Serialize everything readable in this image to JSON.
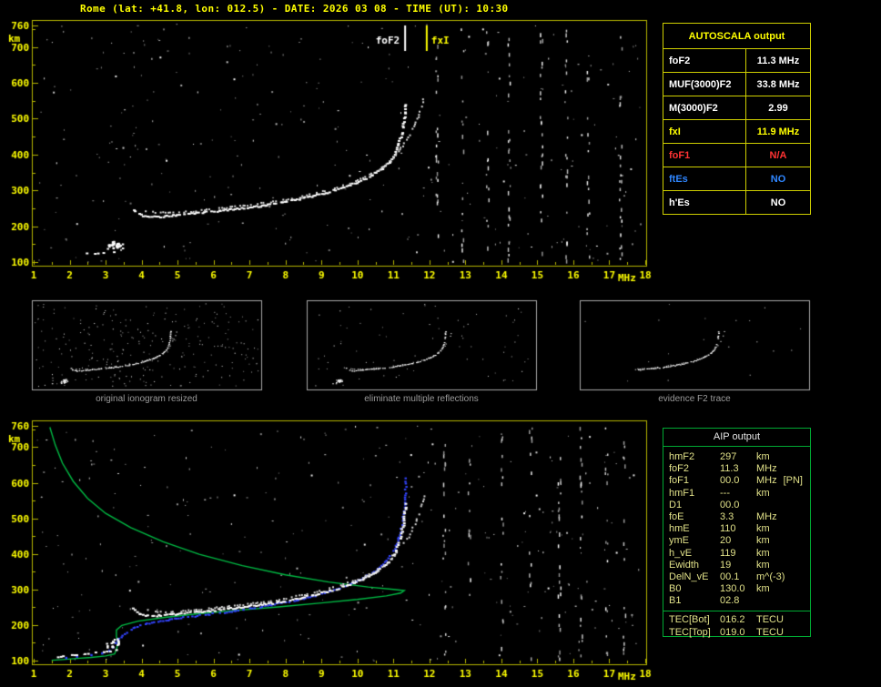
{
  "title": "Rome (lat: +41.8, lon: 012.5) - DATE: 2026 03 08 - TIME (UT): 10:30",
  "colors": {
    "accent_yellow": "#ffff00",
    "plot_border": "#b6b600",
    "profile_green": "#00bb44",
    "trace_blue": "#3344ff",
    "alert_red": "#ff3333",
    "info_blue": "#2f86ff",
    "panel_border": "#a8a8a8",
    "caption_gray": "#9a9a9a"
  },
  "autoscala_table": {
    "title": "AUTOSCALA output",
    "rows": [
      {
        "label": "foF2",
        "value": "11.3 MHz",
        "color": "#ffffff"
      },
      {
        "label": "MUF(3000)F2",
        "value": "33.8 MHz",
        "color": "#ffffff"
      },
      {
        "label": "M(3000)F2",
        "value": "2.99",
        "color": "#ffffff"
      },
      {
        "label": "fxI",
        "value": "11.9 MHz",
        "color": "#ffff00"
      },
      {
        "label": "foF1",
        "value": "N/A",
        "color": "#ff3333"
      },
      {
        "label": "ftEs",
        "value": "NO",
        "color": "#2f86ff"
      },
      {
        "label": "h'Es",
        "value": "NO",
        "color": "#ffffff"
      }
    ]
  },
  "aip_table": {
    "title": "AIP output",
    "rows": [
      {
        "label": "hmF2",
        "value": "297",
        "unit": "km"
      },
      {
        "label": "foF2",
        "value": "11.3",
        "unit": "MHz"
      },
      {
        "label": "foF1",
        "value": "00.0",
        "unit": "MHz",
        "note": "[PN]"
      },
      {
        "label": "hmF1",
        "value": "---",
        "unit": "km"
      },
      {
        "label": "D1",
        "value": "00.0",
        "unit": ""
      },
      {
        "label": "foE",
        "value": "3.3",
        "unit": "MHz"
      },
      {
        "label": "hmE",
        "value": "110",
        "unit": "km"
      },
      {
        "label": "ymE",
        "value": "20",
        "unit": "km"
      },
      {
        "label": "h_vE",
        "value": "119",
        "unit": "km"
      },
      {
        "label": "Ewidth",
        "value": "19",
        "unit": "km"
      },
      {
        "label": "DelN_vE",
        "value": "00.1",
        "unit": "m^(-3)"
      },
      {
        "label": "B0",
        "value": "130.0",
        "unit": "km"
      },
      {
        "label": "B1",
        "value": "02.8",
        "unit": ""
      }
    ],
    "tec_rows": [
      {
        "label": "TEC[Bot]",
        "value": "016.2",
        "unit": "TECU"
      },
      {
        "label": "TEC[Top]",
        "value": "019.0",
        "unit": "TECU"
      }
    ]
  },
  "chart_data": [
    {
      "id": "top_ionogram",
      "type": "scatter",
      "xlabel": "MHz",
      "ylabel": "km",
      "xlim": [
        1,
        18
      ],
      "ylim": [
        100,
        760
      ],
      "x_ticks": [
        1,
        2,
        3,
        4,
        5,
        6,
        7,
        8,
        9,
        10,
        11,
        12,
        13,
        14,
        15,
        16,
        17,
        18
      ],
      "y_ticks": [
        760,
        700,
        600,
        500,
        400,
        300,
        200,
        100
      ],
      "markers": [
        {
          "label": "foF2",
          "f": 11.3,
          "color": "#ffffff"
        },
        {
          "label": "fxI",
          "f": 11.9,
          "color": "#ffff00"
        }
      ],
      "series": [
        {
          "name": "E-region echo trace",
          "style": "dash",
          "color": "#ffffff",
          "points": [
            [
              2.15,
              128
            ],
            [
              2.45,
              127
            ],
            [
              2.75,
              126
            ],
            [
              3.0,
              128
            ],
            [
              3.2,
              130
            ],
            [
              3.35,
              132
            ]
          ]
        },
        {
          "name": "sporadic blob",
          "style": "blob",
          "color": "#ffffff",
          "points": [
            [
              3.1,
              146
            ],
            [
              3.25,
              152
            ],
            [
              3.35,
              149
            ]
          ]
        },
        {
          "name": "F2 ordinary trace",
          "style": "main",
          "color": "#ffffff",
          "points": [
            [
              3.75,
              248
            ],
            [
              3.85,
              238
            ],
            [
              4,
              231
            ],
            [
              4.2,
              228
            ],
            [
              4.5,
              229
            ],
            [
              4.8,
              232
            ],
            [
              5.2,
              236
            ],
            [
              5.6,
              240
            ],
            [
              6,
              244
            ],
            [
              6.4,
              249
            ],
            [
              6.8,
              253
            ],
            [
              7.2,
              258
            ],
            [
              7.6,
              264
            ],
            [
              8,
              271
            ],
            [
              8.4,
              279
            ],
            [
              8.8,
              288
            ],
            [
              9.2,
              298
            ],
            [
              9.6,
              311
            ],
            [
              10,
              326
            ],
            [
              10.3,
              341
            ],
            [
              10.6,
              359
            ],
            [
              10.85,
              380
            ],
            [
              11,
              402
            ],
            [
              11.1,
              426
            ],
            [
              11.18,
              452
            ],
            [
              11.24,
              482
            ],
            [
              11.28,
              515
            ],
            [
              11.31,
              548
            ]
          ]
        },
        {
          "name": "F2 extraordinary trace",
          "style": "thin",
          "color": "#dadada",
          "points": [
            [
              4.1,
              244
            ],
            [
              4.5,
              240
            ],
            [
              5,
              241
            ],
            [
              5.5,
              245
            ],
            [
              6,
              250
            ],
            [
              6.5,
              256
            ],
            [
              7,
              262
            ],
            [
              7.5,
              269
            ],
            [
              8,
              277
            ],
            [
              8.5,
              287
            ],
            [
              9,
              299
            ],
            [
              9.5,
              313
            ],
            [
              10,
              331
            ],
            [
              10.5,
              354
            ],
            [
              10.9,
              383
            ],
            [
              11.15,
              415
            ],
            [
              11.4,
              450
            ],
            [
              11.58,
              487
            ],
            [
              11.72,
              522
            ],
            [
              11.8,
              550
            ],
            [
              11.85,
              570
            ]
          ]
        }
      ],
      "noise": {
        "seed": 11,
        "count": 300,
        "columns": [
          12.2,
          12.9,
          13.6,
          14.2,
          15.1,
          15.8,
          16.4,
          17.3
        ]
      }
    },
    {
      "id": "processing_panels",
      "type": "scatter",
      "source": "top_ionogram",
      "panels": [
        {
          "caption": "original ionogram resized",
          "noise": 260,
          "fmin": 1
        },
        {
          "caption": "eliminate multiple reflections",
          "noise": 70,
          "fmin": 1
        },
        {
          "caption": "evidence F2 trace",
          "noise": 18,
          "fmin": 5
        }
      ]
    },
    {
      "id": "bottom_ionogram",
      "type": "scatter",
      "xlabel": "MHz",
      "ylabel": "km",
      "xlim": [
        1,
        18
      ],
      "ylim": [
        100,
        760
      ],
      "x_ticks": [
        1,
        2,
        3,
        4,
        5,
        6,
        7,
        8,
        9,
        10,
        11,
        12,
        13,
        14,
        15,
        16,
        17,
        18
      ],
      "y_ticks": [
        760,
        700,
        600,
        500,
        400,
        300,
        200,
        100
      ],
      "series": [
        {
          "name": "electron density profile",
          "style": "line",
          "color": "#00bb44",
          "points": [
            [
              1.45,
              756
            ],
            [
              1.6,
              706
            ],
            [
              1.8,
              655
            ],
            [
              2.1,
              604
            ],
            [
              2.5,
              556
            ],
            [
              3.0,
              514
            ],
            [
              3.7,
              474
            ],
            [
              4.6,
              434
            ],
            [
              5.6,
              399
            ],
            [
              6.8,
              367
            ],
            [
              8.0,
              341
            ],
            [
              9.2,
              321
            ],
            [
              10.3,
              307
            ],
            [
              11.0,
              300
            ],
            [
              11.3,
              297
            ],
            [
              11.2,
              290
            ],
            [
              10.8,
              282
            ],
            [
              10.0,
              272
            ],
            [
              9.0,
              262
            ],
            [
              7.8,
              251
            ],
            [
              6.6,
              241
            ],
            [
              5.5,
              231
            ],
            [
              4.6,
              221
            ],
            [
              3.9,
              211
            ],
            [
              3.45,
              199
            ],
            [
              3.3,
              186
            ],
            [
              3.3,
              168
            ],
            [
              3.35,
              150
            ],
            [
              3.3,
              132
            ],
            [
              3.25,
              119
            ],
            [
              3.0,
              113
            ],
            [
              2.6,
              109
            ],
            [
              2.2,
              106
            ],
            [
              1.8,
              103
            ],
            [
              1.5,
              101
            ]
          ]
        },
        {
          "name": "restored trace calculated",
          "style": "blue",
          "color": "#3344ff",
          "points": [
            [
              3.3,
              160
            ],
            [
              3.5,
              178
            ],
            [
              3.8,
              196
            ],
            [
              4.2,
              208
            ],
            [
              4.7,
              217
            ],
            [
              5.2,
              224
            ],
            [
              5.8,
              232
            ],
            [
              6.4,
              240
            ],
            [
              7.0,
              249
            ],
            [
              7.6,
              259
            ],
            [
              8.2,
              271
            ],
            [
              8.8,
              285
            ],
            [
              9.4,
              302
            ],
            [
              9.9,
              322
            ],
            [
              10.35,
              346
            ],
            [
              10.7,
              374
            ],
            [
              10.95,
              406
            ],
            [
              11.12,
              444
            ],
            [
              11.22,
              488
            ],
            [
              11.28,
              535
            ],
            [
              11.31,
              585
            ],
            [
              11.33,
              620
            ]
          ]
        },
        {
          "name": "calculated E trace",
          "style": "bluedots",
          "color": "#3344ff",
          "points": [
            [
              1.9,
              108
            ],
            [
              2.2,
              112
            ],
            [
              2.6,
              116
            ],
            [
              2.9,
              121
            ],
            [
              3.1,
              128
            ],
            [
              3.2,
              138
            ],
            [
              3.28,
              150
            ]
          ]
        },
        {
          "name": "F2 ordinary trace",
          "style": "main",
          "color": "#ffffff",
          "points": [
            [
              3.75,
              248
            ],
            [
              3.85,
              238
            ],
            [
              4,
              231
            ],
            [
              4.2,
              228
            ],
            [
              4.5,
              229
            ],
            [
              4.8,
              232
            ],
            [
              5.2,
              236
            ],
            [
              5.6,
              240
            ],
            [
              6,
              244
            ],
            [
              6.4,
              249
            ],
            [
              6.8,
              253
            ],
            [
              7.2,
              258
            ],
            [
              7.6,
              264
            ],
            [
              8,
              271
            ],
            [
              8.4,
              279
            ],
            [
              8.8,
              288
            ],
            [
              9.2,
              298
            ],
            [
              9.6,
              311
            ],
            [
              10,
              326
            ],
            [
              10.3,
              341
            ],
            [
              10.6,
              359
            ],
            [
              10.85,
              380
            ],
            [
              11,
              402
            ],
            [
              11.1,
              426
            ],
            [
              11.18,
              452
            ],
            [
              11.24,
              482
            ],
            [
              11.28,
              515
            ],
            [
              11.31,
              548
            ]
          ]
        },
        {
          "name": "F2 extraordinary trace",
          "style": "thin",
          "color": "#d8d8d8",
          "points": [
            [
              4.1,
              244
            ],
            [
              4.5,
              240
            ],
            [
              5,
              241
            ],
            [
              5.5,
              245
            ],
            [
              6,
              250
            ],
            [
              6.5,
              256
            ],
            [
              7,
              262
            ],
            [
              7.5,
              269
            ],
            [
              8,
              277
            ],
            [
              8.5,
              287
            ],
            [
              9,
              299
            ],
            [
              9.5,
              313
            ],
            [
              10,
              331
            ],
            [
              10.5,
              354
            ],
            [
              10.9,
              383
            ],
            [
              11.15,
              415
            ],
            [
              11.4,
              450
            ],
            [
              11.58,
              487
            ],
            [
              11.72,
              522
            ],
            [
              11.8,
              550
            ],
            [
              11.85,
              570
            ]
          ]
        },
        {
          "name": "E-region echo trace",
          "style": "dash",
          "color": "#ffffff",
          "points": [
            [
              1.5,
              112
            ],
            [
              1.8,
              114
            ],
            [
              2.1,
              118
            ],
            [
              2.4,
              122
            ],
            [
              2.7,
              125
            ],
            [
              3.0,
              127
            ],
            [
              3.2,
              130
            ],
            [
              3.35,
              133
            ]
          ]
        },
        {
          "name": "sporadic blob",
          "style": "blob",
          "color": "#ffffff",
          "points": [
            [
              3.1,
              148
            ],
            [
              3.25,
              155
            ]
          ]
        }
      ],
      "noise": {
        "seed": 23,
        "count": 300,
        "columns": [
          12.4,
          13.1,
          14.0,
          14.8,
          15.6,
          16.2,
          16.9,
          17.4
        ]
      }
    }
  ]
}
